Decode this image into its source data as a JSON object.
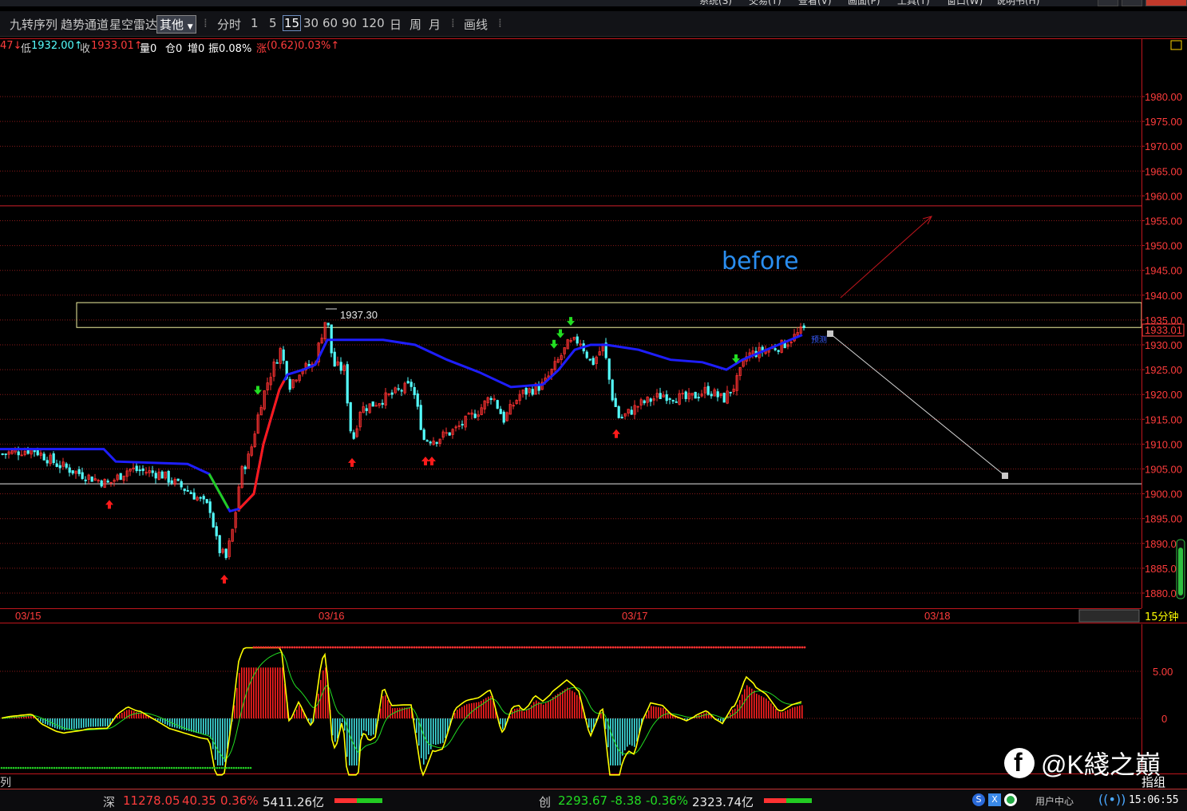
{
  "menu": {
    "items": [
      "系统(S)",
      "交易(T)",
      "查看(V)",
      "画面(P)",
      "工具(T)",
      "窗口(W)",
      "说明书(H)"
    ]
  },
  "toolbar": {
    "items": [
      "九转序列",
      "趋势通道",
      "星空雷达"
    ],
    "dropdown": "其他",
    "periods": [
      "分时",
      "1",
      "5",
      "15",
      "30",
      "60",
      "90",
      "120",
      "日",
      "周",
      "月"
    ],
    "active_period": "15",
    "draw_label": "画线"
  },
  "info": {
    "prefix": "47↓",
    "low_label": "低",
    "low_value": "1932.00↑",
    "close_label": "收",
    "close_value": "1933.01↑",
    "volume": "量0",
    "position": "仓0",
    "increase": "增0",
    "amplitude": "振0.08%",
    "change_label": "涨",
    "change_value": "(0.62)0.03%↑"
  },
  "chart_data": [
    {
      "type": "candlestick",
      "period": "15分钟",
      "y_ticks": [
        1980.0,
        1975.0,
        1970.0,
        1965.0,
        1960.0,
        1955.0,
        1950.0,
        1945.0,
        1940.0,
        1935.0,
        1930.0,
        1925.0,
        1920.0,
        1915.0,
        1910.0,
        1905.0,
        1900.0,
        1895.0,
        1890.0,
        1885.0,
        1880.0
      ],
      "ylim": [
        1878.0,
        1984.0
      ],
      "x_labels": [
        "03/15",
        "03/16",
        "03/17",
        "03/18"
      ],
      "last_price": "1933.01",
      "peak_label": "1937.30",
      "annotation_text": "before",
      "annotation_small": "预测",
      "series": [
        {
          "name": "",
          "color": "#1e1eff",
          "x": [
            0,
            130,
            145,
            235,
            262,
            288,
            300,
            318,
            330,
            350,
            360,
            380,
            395,
            410,
            430,
            480,
            520,
            560,
            600,
            640,
            680,
            700,
            720,
            740,
            760,
            800,
            840,
            880,
            910,
            930,
            960,
            990,
            1005
          ],
          "y": [
            1909,
            1909,
            1906.5,
            1906,
            1904,
            1896.5,
            1897,
            1900,
            1910,
            1921,
            1924,
            1925,
            1926,
            1931,
            1931,
            1931,
            1930,
            1927,
            1924.5,
            1921.5,
            1922,
            1925,
            1929,
            1930,
            1930,
            1929,
            1927,
            1926.5,
            1925,
            1927,
            1929,
            1931,
            1932
          ]
        }
      ],
      "levels": {
        "red_line": 1958.0,
        "box_top": 1938.5,
        "box_bottom": 1933.5,
        "white_line": 1902.0
      },
      "up_arrows_x": [
        137,
        281,
        441,
        533,
        541,
        772
      ],
      "down_arrows_x": [
        323,
        694,
        702,
        715,
        922
      ],
      "colors": {
        "up": "#ff3232",
        "down": "#54ffff",
        "grid": "#8a1a1a",
        "axis_text": "#ff3c3c"
      }
    },
    {
      "type": "macd",
      "y_ticks": [
        5.0,
        0
      ],
      "ylim": [
        -10,
        8.5
      ],
      "colors": {
        "dif": "#ffff00",
        "dea": "#22dd22",
        "pos": "#ff2020",
        "neg": "#40e0e0"
      }
    }
  ],
  "status": {
    "shen_label": "深",
    "shen_value": "11278.05",
    "shen_change": "40.35",
    "shen_pct": "0.36%",
    "shen_amount": "5411.26亿",
    "chuang_label": "创",
    "chuang_value": "2293.67",
    "chuang_change": "-8.38",
    "chuang_pct": "-0.36%",
    "chuang_amount": "2323.74亿",
    "user_center": "用户中心",
    "time": "15:06:55",
    "left_label": "列",
    "right_label": "指组"
  },
  "watermark": "@K綫之巔"
}
